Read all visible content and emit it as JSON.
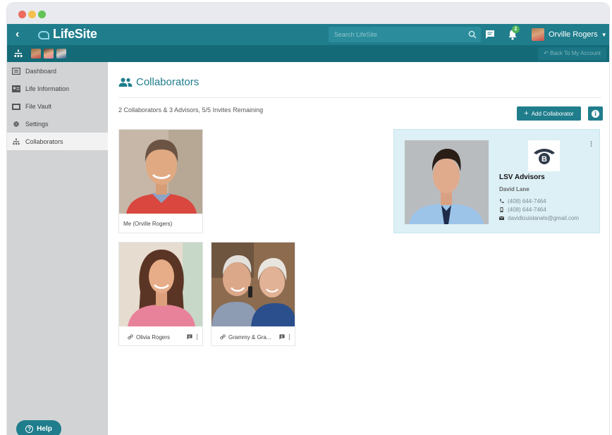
{
  "app": {
    "brand": "LifeSite",
    "search_placeholder": "Search LifeSite",
    "notification_count": "2",
    "user_name": "Orville Rogers",
    "back_to_account": "Back To My Account"
  },
  "sidebar": {
    "items": [
      {
        "label": "Dashboard",
        "icon": "dashboard-icon"
      },
      {
        "label": "Life Information",
        "icon": "id-card-icon"
      },
      {
        "label": "File Vault",
        "icon": "folder-icon"
      },
      {
        "label": "Settings",
        "icon": "gear-icon"
      },
      {
        "label": "Collaborators",
        "icon": "collaborators-icon",
        "active": true
      }
    ],
    "help_label": "Help"
  },
  "main": {
    "title": "Collaborators",
    "summary": "2 Collaborators & 3 Advisors, 5/5 Invites Remaining",
    "add_button": "Add Collaborator",
    "cards": {
      "me": {
        "label": "Me (Orville Rogers)"
      },
      "collaborators": [
        {
          "name": "Olivia Rogers"
        },
        {
          "name": "Grammy & Gra..."
        }
      ]
    },
    "advisor": {
      "firm": "LSV Advisors",
      "person": "David Lane",
      "phone": "(408) 644-7464",
      "mobile": "(408) 644-7464",
      "email": "davidlouislanels@gmail.com"
    }
  },
  "colors": {
    "primary": "#1f7d8c",
    "primary_dark": "#146a77",
    "sidebar_bg": "#d1d3d4",
    "advisor_bg": "#dcf0f5"
  }
}
